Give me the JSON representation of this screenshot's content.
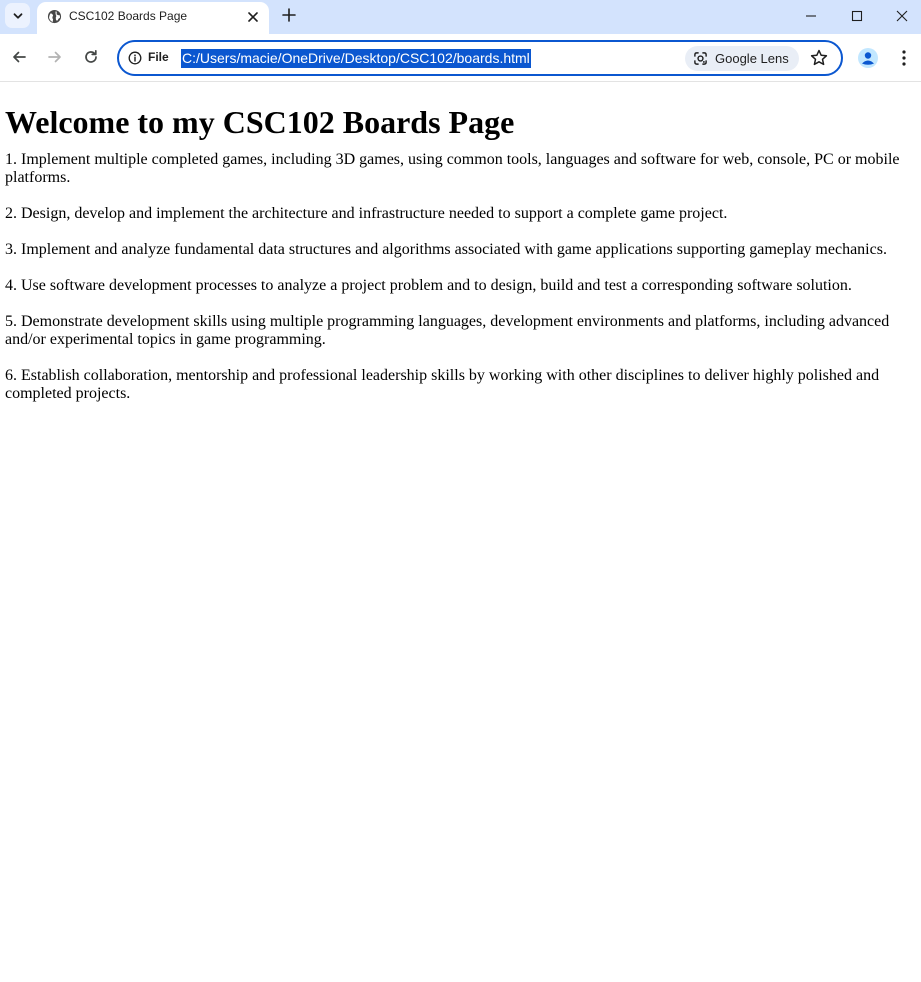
{
  "browser": {
    "tab": {
      "title": "CSC102 Boards Page"
    },
    "address_bar": {
      "scheme_label": "File",
      "url": "C:/Users/macie/OneDrive/Desktop/CSC102/boards.html"
    },
    "lens_label": "Google Lens",
    "icons": [
      "tab-search-icon",
      "globe-icon",
      "close-icon",
      "plus-icon",
      "minimize-icon",
      "maximize-icon",
      "window-close-icon",
      "back-arrow-icon",
      "forward-arrow-icon",
      "reload-icon",
      "info-icon",
      "lens-icon",
      "star-icon",
      "profile-icon",
      "kebab-menu-icon"
    ],
    "colors": {
      "tabstrip": "#d3e3fd",
      "accent": "#0b57d0"
    }
  },
  "page": {
    "heading": "Welcome to my CSC102 Boards Page",
    "items": [
      "1. Implement multiple completed games, including 3D games, using common tools, languages and software for web, console, PC or mobile platforms.",
      "2. Design, develop and implement the architecture and infrastructure needed to support a complete game project.",
      "3. Implement and analyze fundamental data structures and algorithms associated with game applications supporting gameplay mechanics.",
      "4. Use software development processes to analyze a project problem and to design, build and test a corresponding software solution.",
      "5. Demonstrate development skills using multiple programming languages, development environments and platforms, including advanced and/or experimental topics in game programming.",
      "6. Establish collaboration, mentorship and professional leadership skills by working with other disciplines to deliver highly polished and completed projects."
    ]
  }
}
